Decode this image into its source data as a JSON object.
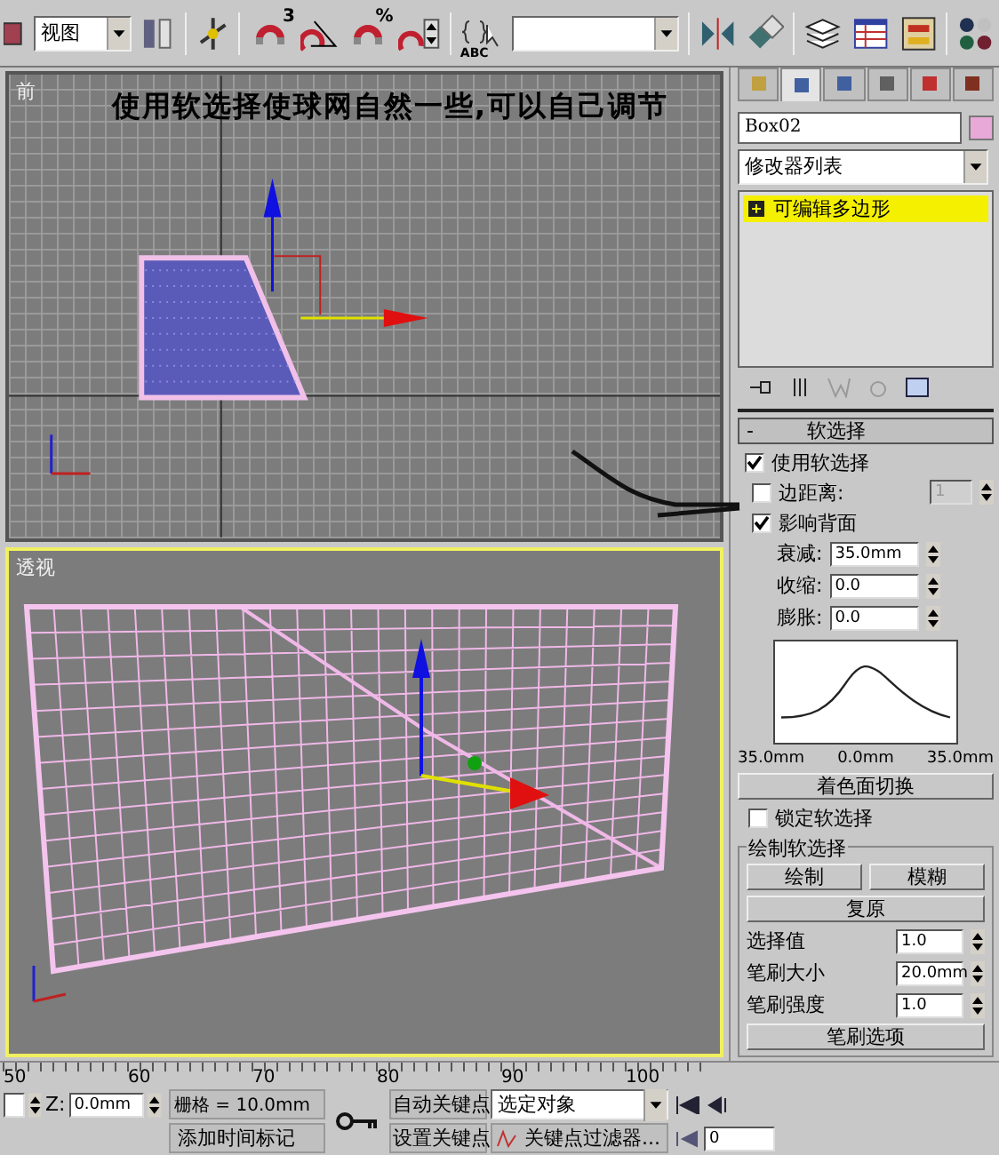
{
  "toolbar": {
    "reference_dropdown": "视图",
    "snap_badges": [
      "3",
      "%"
    ],
    "named_selection_label": "ABC"
  },
  "annotation": "使用软选择使球网自然一些,可以自己调节",
  "viewports": [
    {
      "label": "前",
      "kind": "front",
      "active": false
    },
    {
      "label": "透视",
      "kind": "perspective",
      "active": true
    }
  ],
  "command_panel": {
    "tabs": [
      {
        "selected": false
      },
      {
        "selected": true
      },
      {
        "selected": false
      },
      {
        "selected": false
      },
      {
        "selected": false
      },
      {
        "selected": false
      }
    ],
    "object_name": "Box02",
    "modifier_list": "修改器列表",
    "stack": [
      {
        "label": "可编辑多边形",
        "selected": true
      }
    ],
    "rollout": {
      "sign": "-",
      "title": "软选择",
      "expanded": true
    },
    "checks": [
      {
        "label": "使用软选择",
        "checked": true
      },
      {
        "label": "边距离:",
        "checked": false,
        "value": "1",
        "disabled": true
      },
      {
        "label": "影响背面",
        "checked": true
      }
    ],
    "params": [
      {
        "label": "衰减:",
        "value": "35.0mm"
      },
      {
        "label": "收缩:",
        "value": "0.0"
      },
      {
        "label": "膨胀:",
        "value": "0.0"
      }
    ],
    "curve_labels": [
      "35.0mm",
      "0.0mm",
      "35.0mm"
    ],
    "shade_button": "着色面切换",
    "lock": {
      "label": "锁定软选择",
      "checked": false
    },
    "paint_group": {
      "title": "绘制软选择",
      "buttons": [
        "绘制",
        "模糊"
      ],
      "revert_button": "复原",
      "params": [
        {
          "label": "选择值",
          "value": "1.0"
        },
        {
          "label": "笔刷大小",
          "value": "20.0mm"
        },
        {
          "label": "笔刷强度",
          "value": "1.0"
        }
      ],
      "options_button": "笔刷选项"
    }
  },
  "timeline": {
    "ruler_labels": [
      "50",
      "60",
      "70",
      "80",
      "90",
      "100"
    ]
  },
  "status": {
    "z_label": "Z:",
    "z_value": "0.0mm",
    "grid": "栅格 = 10.0mm",
    "add_time_tag": "添加时间标记",
    "auto_key": "自动关键点",
    "set_key": "设置关键点",
    "key_mode": "选定对象",
    "key_filters": "关键点过滤器...",
    "frame": "0"
  }
}
